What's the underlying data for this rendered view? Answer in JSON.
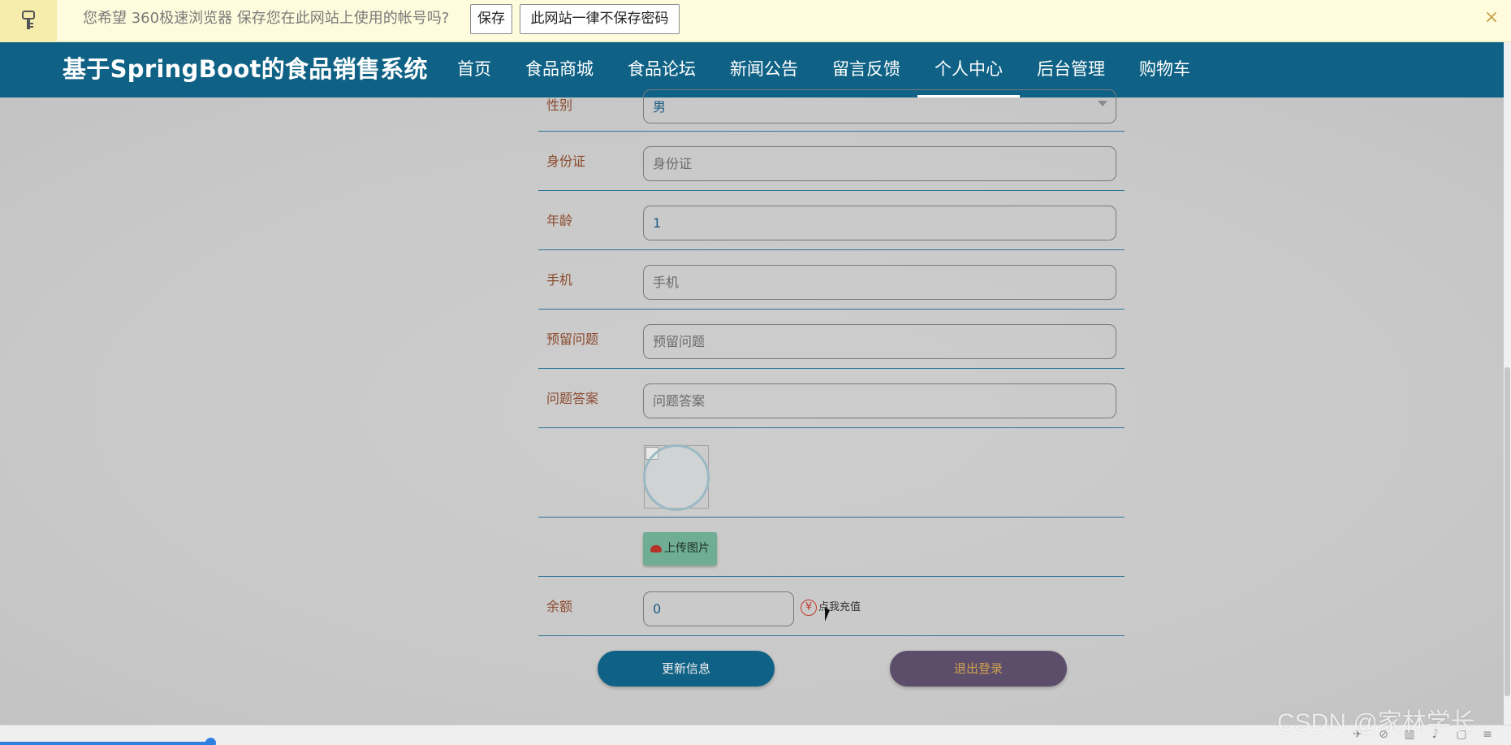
{
  "password_bar": {
    "message": "您希望 360极速浏览器 保存您在此网站上使用的帐号吗?",
    "save_label": "保存",
    "never_label": "此网站一律不保存密码",
    "close_glyph": "×"
  },
  "nav": {
    "brand": "基于SpringBoot的食品销售系统",
    "items": [
      {
        "label": "首页"
      },
      {
        "label": "食品商城"
      },
      {
        "label": "食品论坛"
      },
      {
        "label": "新闻公告"
      },
      {
        "label": "留言反馈"
      },
      {
        "label": "个人中心",
        "active": true
      },
      {
        "label": "后台管理"
      },
      {
        "label": "购物车"
      }
    ]
  },
  "form": {
    "gender": {
      "label": "性别",
      "value": "男"
    },
    "id_card": {
      "label": "身份证",
      "placeholder": "身份证"
    },
    "age": {
      "label": "年龄",
      "value": "1"
    },
    "phone": {
      "label": "手机",
      "placeholder": "手机"
    },
    "question": {
      "label": "预留问题",
      "placeholder": "预留问题"
    },
    "answer": {
      "label": "问题答案",
      "placeholder": "问题答案"
    },
    "upload_label": "上传图片",
    "balance": {
      "label": "余额",
      "value": "0"
    },
    "recharge_label": "点我充值",
    "recharge_icon": "¥",
    "update_label": "更新信息",
    "logout_label": "退出登录"
  },
  "watermark": "CSDN @家林学长",
  "colors": {
    "nav_bg": "#0f6285",
    "label": "#8b4a2e",
    "upload_btn": "#6fae95",
    "logout_btn": "#5c4e6a",
    "logout_text": "#d0a050"
  }
}
